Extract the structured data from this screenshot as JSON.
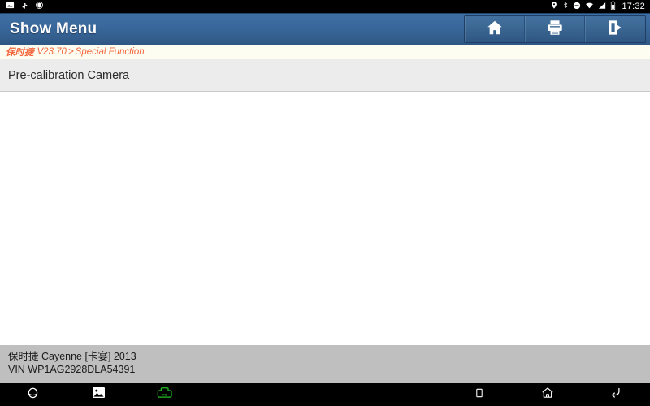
{
  "statusbar": {
    "left_icons": [
      "screenshot-icon",
      "usb-icon",
      "debug-icon"
    ],
    "right_icons": [
      "location-icon",
      "bluetooth-icon",
      "dnd-icon",
      "wifi-icon",
      "signal-icon",
      "battery-icon"
    ],
    "time": "17:32"
  },
  "titlebar": {
    "title": "Show Menu",
    "buttons": [
      {
        "name": "home-button",
        "icon": "home-icon"
      },
      {
        "name": "print-button",
        "icon": "print-icon"
      },
      {
        "name": "exit-button",
        "icon": "exit-icon"
      }
    ]
  },
  "breadcrumb": {
    "brand": "保时捷",
    "version": "V23.70",
    "separator": ">",
    "section": "Special Function"
  },
  "menu": {
    "items": [
      {
        "label": "Pre-calibration Camera"
      }
    ]
  },
  "vehicle": {
    "line1": "保时捷 Cayenne [卡宴] 2013",
    "line2": "VIN WP1AG2928DLA54391"
  },
  "navbar": {
    "left": [
      "browser-icon",
      "gallery-icon",
      "vci-icon"
    ],
    "right": [
      "recents-icon",
      "home-icon",
      "back-icon"
    ]
  },
  "colors": {
    "titlebar_top": "#3e6fa4",
    "titlebar_bottom": "#2f5784",
    "breadcrumb_text": "#f4663c",
    "menu_row": "#ececec",
    "vehicle_bar": "#bfbfbf",
    "vci_green": "#22c022"
  }
}
